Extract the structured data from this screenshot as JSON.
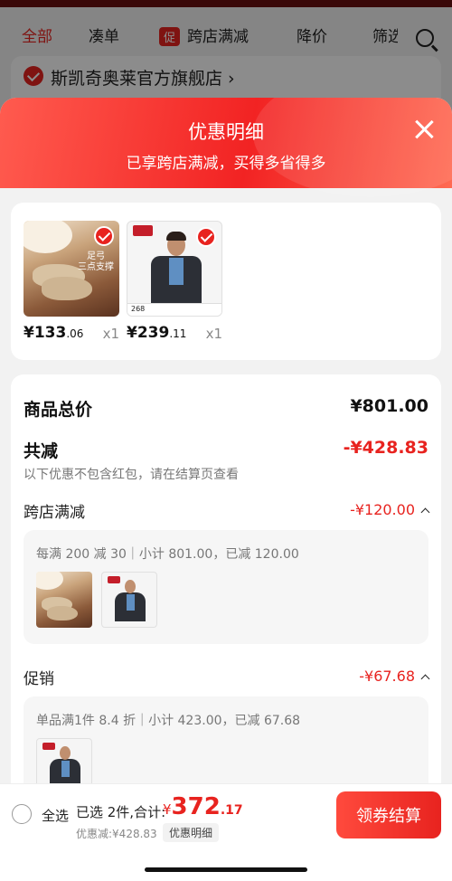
{
  "filter_tabs": [
    {
      "label": "全部"
    },
    {
      "label": "凑单"
    },
    {
      "tag": "促",
      "label": "跨店满减"
    },
    {
      "label": "降价"
    },
    {
      "label": "筛选"
    }
  ],
  "store": {
    "name": "斯凯奇奥莱官方旗舰店 ›"
  },
  "sheet": {
    "title": "优惠明细",
    "subtitle": "已享跨店满减，买得多省得多"
  },
  "products": [
    {
      "price_main": "¥133",
      "price_dec": ".06",
      "qty": "x1",
      "img_text": "足弓\n三点支撑"
    },
    {
      "price_main": "¥239",
      "price_dec": ".11",
      "qty": "x1",
      "img_text": "268"
    }
  ],
  "summary": {
    "total_label": "商品总价",
    "total_value": "¥801.00",
    "discount_label": "共减",
    "discount_value": "-¥428.83",
    "note": "以下优惠不包含红包，请在结算页查看"
  },
  "sections": [
    {
      "title": "跨店满减",
      "value": "-¥120.00",
      "detail": "每满 200 减 30｜小计 801.00，已减 120.00"
    },
    {
      "title": "促销",
      "value": "-¥67.68",
      "detail": "单品满1件 8.4 折｜小计 423.00，已减 67.68"
    }
  ],
  "bottom": {
    "select_all": "全选",
    "selected": "已选 2件,合计:",
    "currency": "¥",
    "total_main": "372",
    "total_dec": ".17",
    "discount_small": "优惠减:¥428.83",
    "detail_chip": "优惠明细",
    "checkout": "领券结算"
  },
  "colors": {
    "accent": "#e8231f",
    "header_gradient_start": "#ff5b4f",
    "header_gradient_end": "#f22323"
  }
}
